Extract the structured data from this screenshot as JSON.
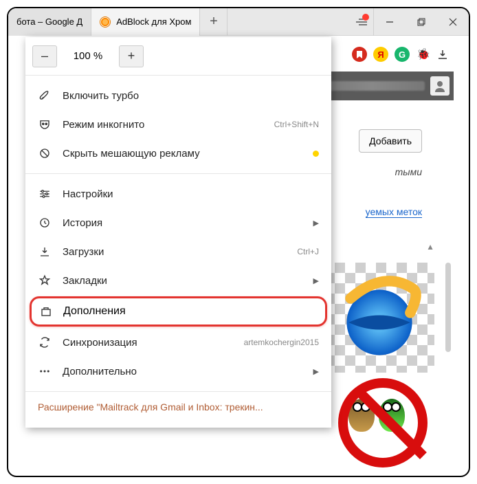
{
  "tabs": [
    {
      "label": "бота – Google Д",
      "favicon_color": "#ffffff"
    },
    {
      "label": "AdBlock для Хром",
      "favicon_color": "#ff8a00"
    }
  ],
  "zoom": {
    "minus": "–",
    "value": "100 %",
    "plus": "+"
  },
  "menu": {
    "turbo": "Включить турбо",
    "incognito": "Режим инкогнито",
    "incognito_shortcut": "Ctrl+Shift+N",
    "hide_ads": "Скрыть мешающую рекламу",
    "settings": "Настройки",
    "history": "История",
    "downloads": "Загрузки",
    "downloads_shortcut": "Ctrl+J",
    "bookmarks": "Закладки",
    "addons": "Дополнения",
    "sync": "Синхронизация",
    "sync_account": "artemkochergin2015",
    "more": "Дополнительно"
  },
  "notice": "Расширение \"Mailtrack для Gmail и Inbox: трекин...",
  "page": {
    "add_button": "Добавить",
    "text_fragment": "тыми",
    "link_fragment": "уемых меток"
  },
  "extensions": {
    "icons": [
      "bookmark-ext",
      "yandex-ext",
      "grammarly-ext",
      "bug-ext"
    ],
    "colors": [
      "#d52b1e",
      "#ffcc00",
      "#18b66c",
      "#222"
    ]
  }
}
